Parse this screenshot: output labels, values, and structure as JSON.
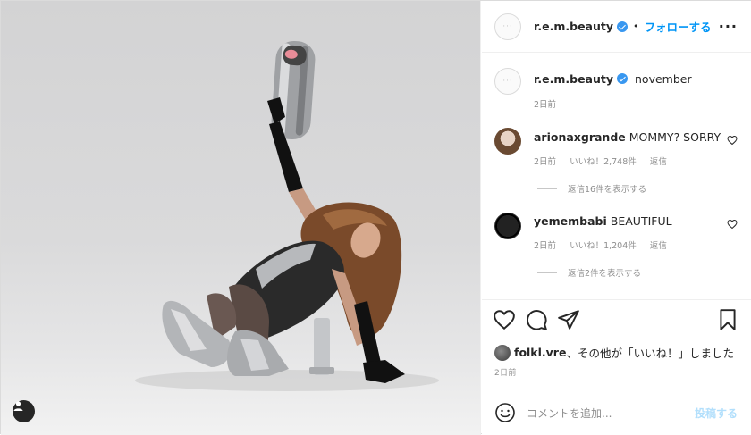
{
  "post": {
    "author": "r.e.m.beauty",
    "follow_label": "フォローする",
    "separator": "•",
    "more_label": "···"
  },
  "caption": {
    "username": "r.e.m.beauty",
    "text": "november",
    "time": "2日前"
  },
  "comments": [
    {
      "username": "arionaxgrande",
      "text": "MOMMY? SORRY",
      "time": "2日前",
      "likes": "いいね！2,748件",
      "reply": "返信",
      "view_replies": "返信16件を表示する"
    },
    {
      "username": "yemembabi",
      "text": "BEAUTIFUL",
      "time": "2日前",
      "likes": "いいね！1,204件",
      "reply": "返信",
      "view_replies": "返信2件を表示する"
    }
  ],
  "liked_by": {
    "username": "folkl.vre",
    "suffix": "、その他が「いいね！」しました"
  },
  "posted_time": "2日前",
  "comment_box": {
    "placeholder": "コメントを追加...",
    "post_label": "投稿する"
  },
  "colors": {
    "accent": "#0095f6",
    "verified": "#3897f0",
    "muted": "#8e8e8e",
    "post_disabled": "#b2dffc"
  },
  "icons": [
    "tag-user-icon",
    "verified-badge-icon",
    "more-options-icon",
    "heart-icon",
    "comment-icon",
    "share-icon",
    "bookmark-icon",
    "emoji-icon"
  ]
}
